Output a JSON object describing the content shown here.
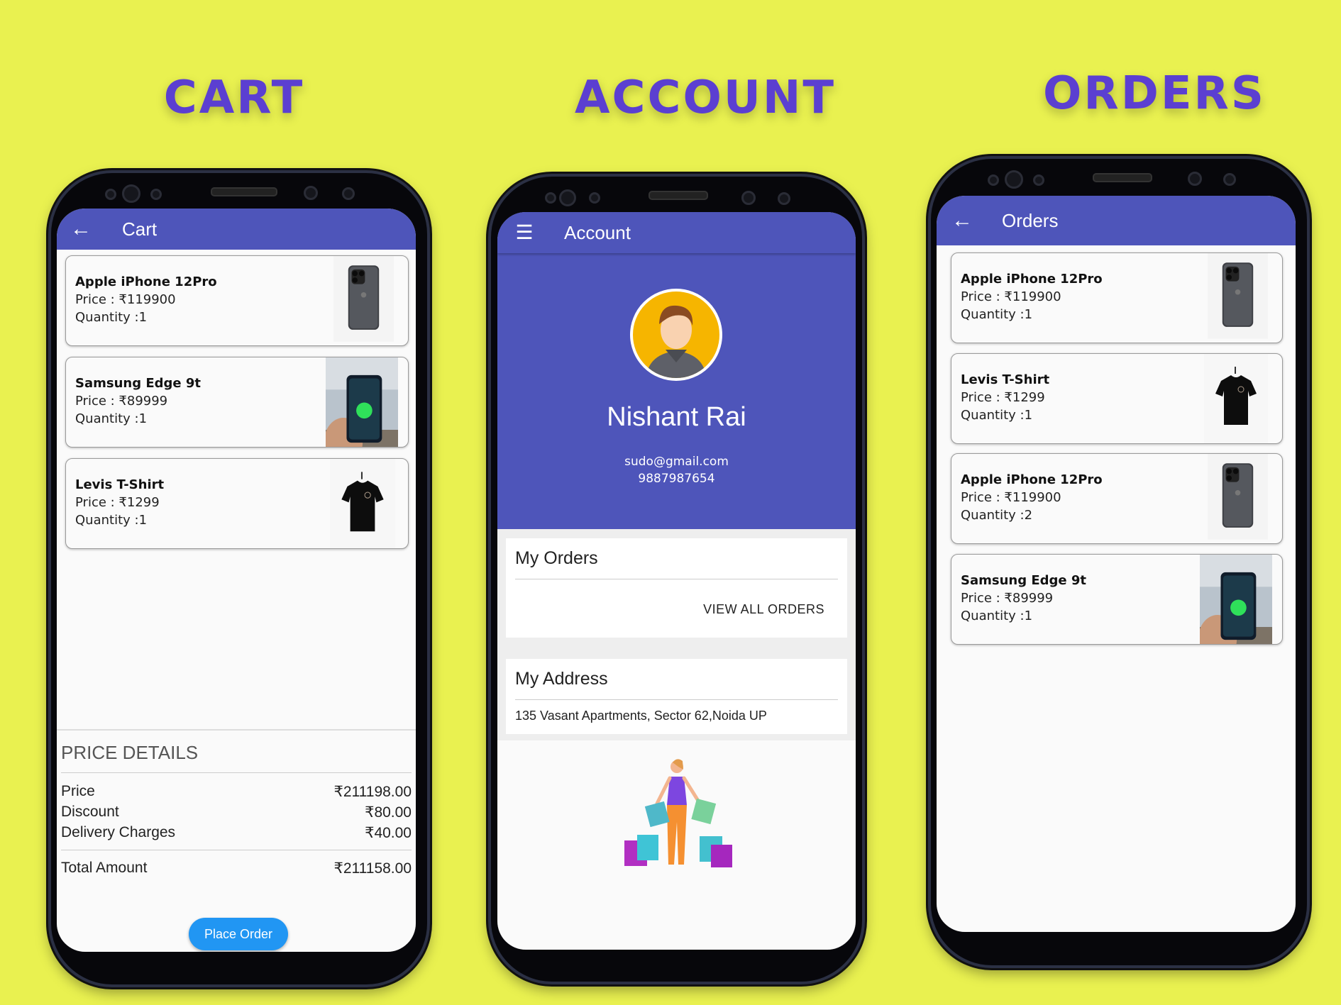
{
  "headings": {
    "cart": "CART",
    "account": "ACCOUNT",
    "orders": "ORDERS"
  },
  "cart": {
    "title": "Cart",
    "items": [
      {
        "name": "Apple iPhone 12Pro",
        "price": "Price : ₹119900",
        "qty": "Quantity :1",
        "thumb": "iphone"
      },
      {
        "name": "Samsung Edge 9t",
        "price": "Price : ₹89999",
        "qty": "Quantity :1",
        "thumb": "samsung"
      },
      {
        "name": "Levis T-Shirt",
        "price": "Price : ₹1299",
        "qty": "Quantity :1",
        "thumb": "tshirt"
      }
    ],
    "price_details": {
      "heading": "PRICE DETAILS",
      "rows": [
        {
          "label": "Price",
          "value": "₹211198.00"
        },
        {
          "label": "Discount",
          "value": "₹80.00"
        },
        {
          "label": "Delivery Charges",
          "value": "₹40.00"
        }
      ],
      "total_label": "Total Amount",
      "total_value": "₹211158.00"
    },
    "place_order": "Place Order"
  },
  "account": {
    "title": "Account",
    "name": "Nishant Rai",
    "email": "sudo@gmail.com",
    "phone": "9887987654",
    "my_orders": "My Orders",
    "view_all": "VIEW ALL ORDERS",
    "my_address": "My Address",
    "address": "135 Vasant Apartments, Sector 62,Noida UP"
  },
  "orders": {
    "title": "Orders",
    "items": [
      {
        "name": "Apple iPhone 12Pro",
        "price": "Price : ₹119900",
        "qty": "Quantity :1",
        "thumb": "iphone"
      },
      {
        "name": "Levis T-Shirt",
        "price": "Price : ₹1299",
        "qty": "Quantity :1",
        "thumb": "tshirt"
      },
      {
        "name": "Apple iPhone 12Pro",
        "price": "Price : ₹119900",
        "qty": "Quantity :2",
        "thumb": "iphone"
      },
      {
        "name": "Samsung Edge 9t",
        "price": "Price : ₹89999",
        "qty": "Quantity :1",
        "thumb": "samsung"
      }
    ]
  },
  "colors": {
    "background": "#e9f150",
    "appbar": "#4e55ba",
    "heading": "#5b3fd1",
    "button": "#2196f3"
  }
}
